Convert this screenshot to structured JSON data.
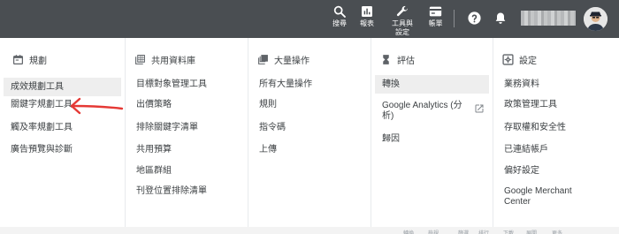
{
  "topbar": {
    "search_label": "搜尋",
    "reports_label": "報表",
    "tools_label_line1": "工具與",
    "tools_label_line2": "設定",
    "billing_label": "帳單"
  },
  "columns": [
    {
      "title": "規劃",
      "icon": "calendar-icon",
      "items": [
        "成效規劃工具",
        "關鍵字規劃工具",
        "觸及率規劃工具",
        "廣告預覽與診斷"
      ],
      "selected": 0
    },
    {
      "title": "共用資料庫",
      "icon": "library-grid-icon",
      "items": [
        "目標對象管理工具",
        "出價策略",
        "排除關鍵字清單",
        "共用預算",
        "地區群組",
        "刊登位置排除清單"
      ]
    },
    {
      "title": "大量操作",
      "icon": "bulk-copy-icon",
      "items": [
        "所有大量操作",
        "規則",
        "指令碼",
        "上傳"
      ]
    },
    {
      "title": "評估",
      "icon": "hourglass-icon",
      "items": [
        "轉換",
        "Google Analytics (分析)",
        "歸因"
      ],
      "selected": 0
    },
    {
      "title": "設定",
      "icon": "settings-icon",
      "items": [
        "業務資料",
        "政策管理工具",
        "存取權和安全性",
        "已連結帳戶",
        "偏好設定",
        "Google Merchant Center"
      ]
    }
  ],
  "bottom_strip": [
    "轉換",
    "檢視",
    "篩選",
    "排行",
    "下載",
    "展開",
    "更多"
  ],
  "colors": {
    "topbar": "#4a4e52",
    "selected_bg": "#eeeeee",
    "arrow": "#e53935"
  }
}
